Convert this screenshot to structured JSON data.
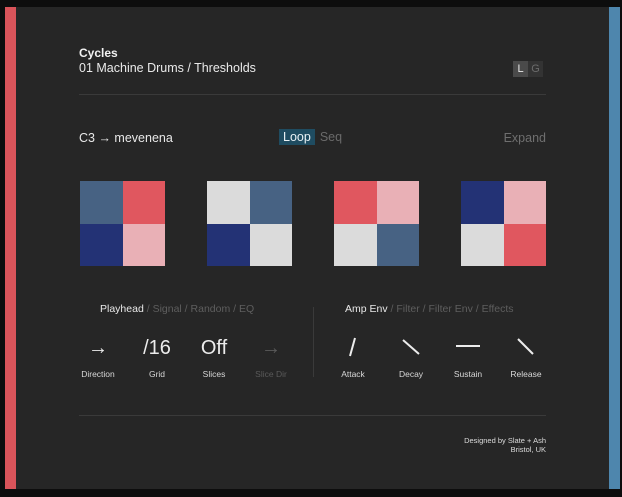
{
  "header": {
    "title": "Cycles",
    "subtitle": "01 Machine Drums / Thresholds",
    "toggle": [
      {
        "label": "L",
        "active": true
      },
      {
        "label": "G",
        "active": false
      }
    ]
  },
  "toolbar": {
    "note": "C3 → mevenena",
    "tabs": [
      {
        "label": "Loop",
        "active": true
      },
      {
        "label": "Seq",
        "active": false
      }
    ],
    "expand": "Expand"
  },
  "colors": {
    "red": "#e0575f",
    "pink": "#e9b0b6",
    "navy": "#233275",
    "slate": "#476283",
    "light": "#dbdbdb",
    "accent_left": "#d9545a",
    "accent_right": "#4e86ad"
  },
  "pads": [
    {
      "cells": [
        "slate",
        "red",
        "navy",
        "pink"
      ]
    },
    {
      "cells": [
        "light",
        "slate",
        "navy",
        "light"
      ]
    },
    {
      "cells": [
        "red",
        "pink",
        "light",
        "slate"
      ]
    },
    {
      "cells": [
        "navy",
        "pink",
        "light",
        "red"
      ]
    }
  ],
  "left_panel": {
    "nav": [
      {
        "label": "Playhead",
        "active": true
      },
      {
        "label": "Signal",
        "active": false
      },
      {
        "label": "Random",
        "active": false
      },
      {
        "label": "EQ",
        "active": false
      }
    ],
    "params": [
      {
        "value": "→",
        "label": "Direction",
        "dim": false
      },
      {
        "value": "/16",
        "label": "Grid",
        "dim": false
      },
      {
        "value": "Off",
        "label": "Slices",
        "dim": false
      },
      {
        "value": "→",
        "label": "Slice Dir",
        "dim": true
      }
    ]
  },
  "right_panel": {
    "nav": [
      {
        "label": "Amp Env",
        "active": true
      },
      {
        "label": "Filter",
        "active": false
      },
      {
        "label": "Filter Env",
        "active": false
      },
      {
        "label": "Effects",
        "active": false
      }
    ],
    "params": [
      {
        "shape": "steep-rise",
        "label": "Attack"
      },
      {
        "shape": "fall",
        "label": "Decay"
      },
      {
        "shape": "flat",
        "label": "Sustain"
      },
      {
        "shape": "fall",
        "label": "Release"
      }
    ]
  },
  "footer": {
    "line1": "Designed by Slate + Ash",
    "line2": "Bristol, UK"
  }
}
